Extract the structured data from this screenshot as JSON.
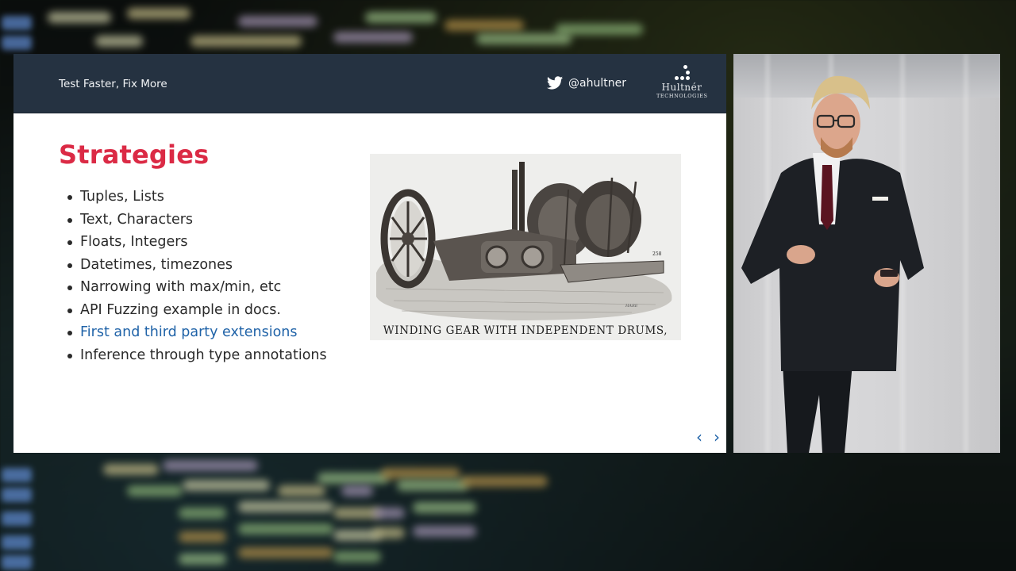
{
  "slide": {
    "header_title": "Test Faster, Fix More",
    "twitter_handle": "@ahultner",
    "logo": {
      "name": "Hultnér",
      "subtitle": "Technologies"
    },
    "heading": "Strategies",
    "bullets": [
      {
        "text": "Tuples, Lists",
        "link": false
      },
      {
        "text": "Text, Characters",
        "link": false
      },
      {
        "text": "Floats, Integers",
        "link": false
      },
      {
        "text": "Datetimes, timezones",
        "link": false
      },
      {
        "text": "Narrowing with max/min, etc",
        "link": false
      },
      {
        "text": "API Fuzzing example in docs.",
        "link": false
      },
      {
        "text": "First and third party extensions",
        "link": true
      },
      {
        "text": "Inference through type annotations",
        "link": false
      }
    ],
    "figure": {
      "caption": "WINDING GEAR WITH INDEPENDENT DRUMS,",
      "plate_number": "258",
      "signature": "HARE"
    },
    "nav": {
      "prev_icon": "chevron-left-icon",
      "next_icon": "chevron-right-icon",
      "prev": "‹",
      "next": "›"
    },
    "colors": {
      "header_bg": "#253241",
      "heading": "#db2a45",
      "link": "#2063a8"
    }
  },
  "video": {
    "subject": "speaker-on-stage"
  }
}
